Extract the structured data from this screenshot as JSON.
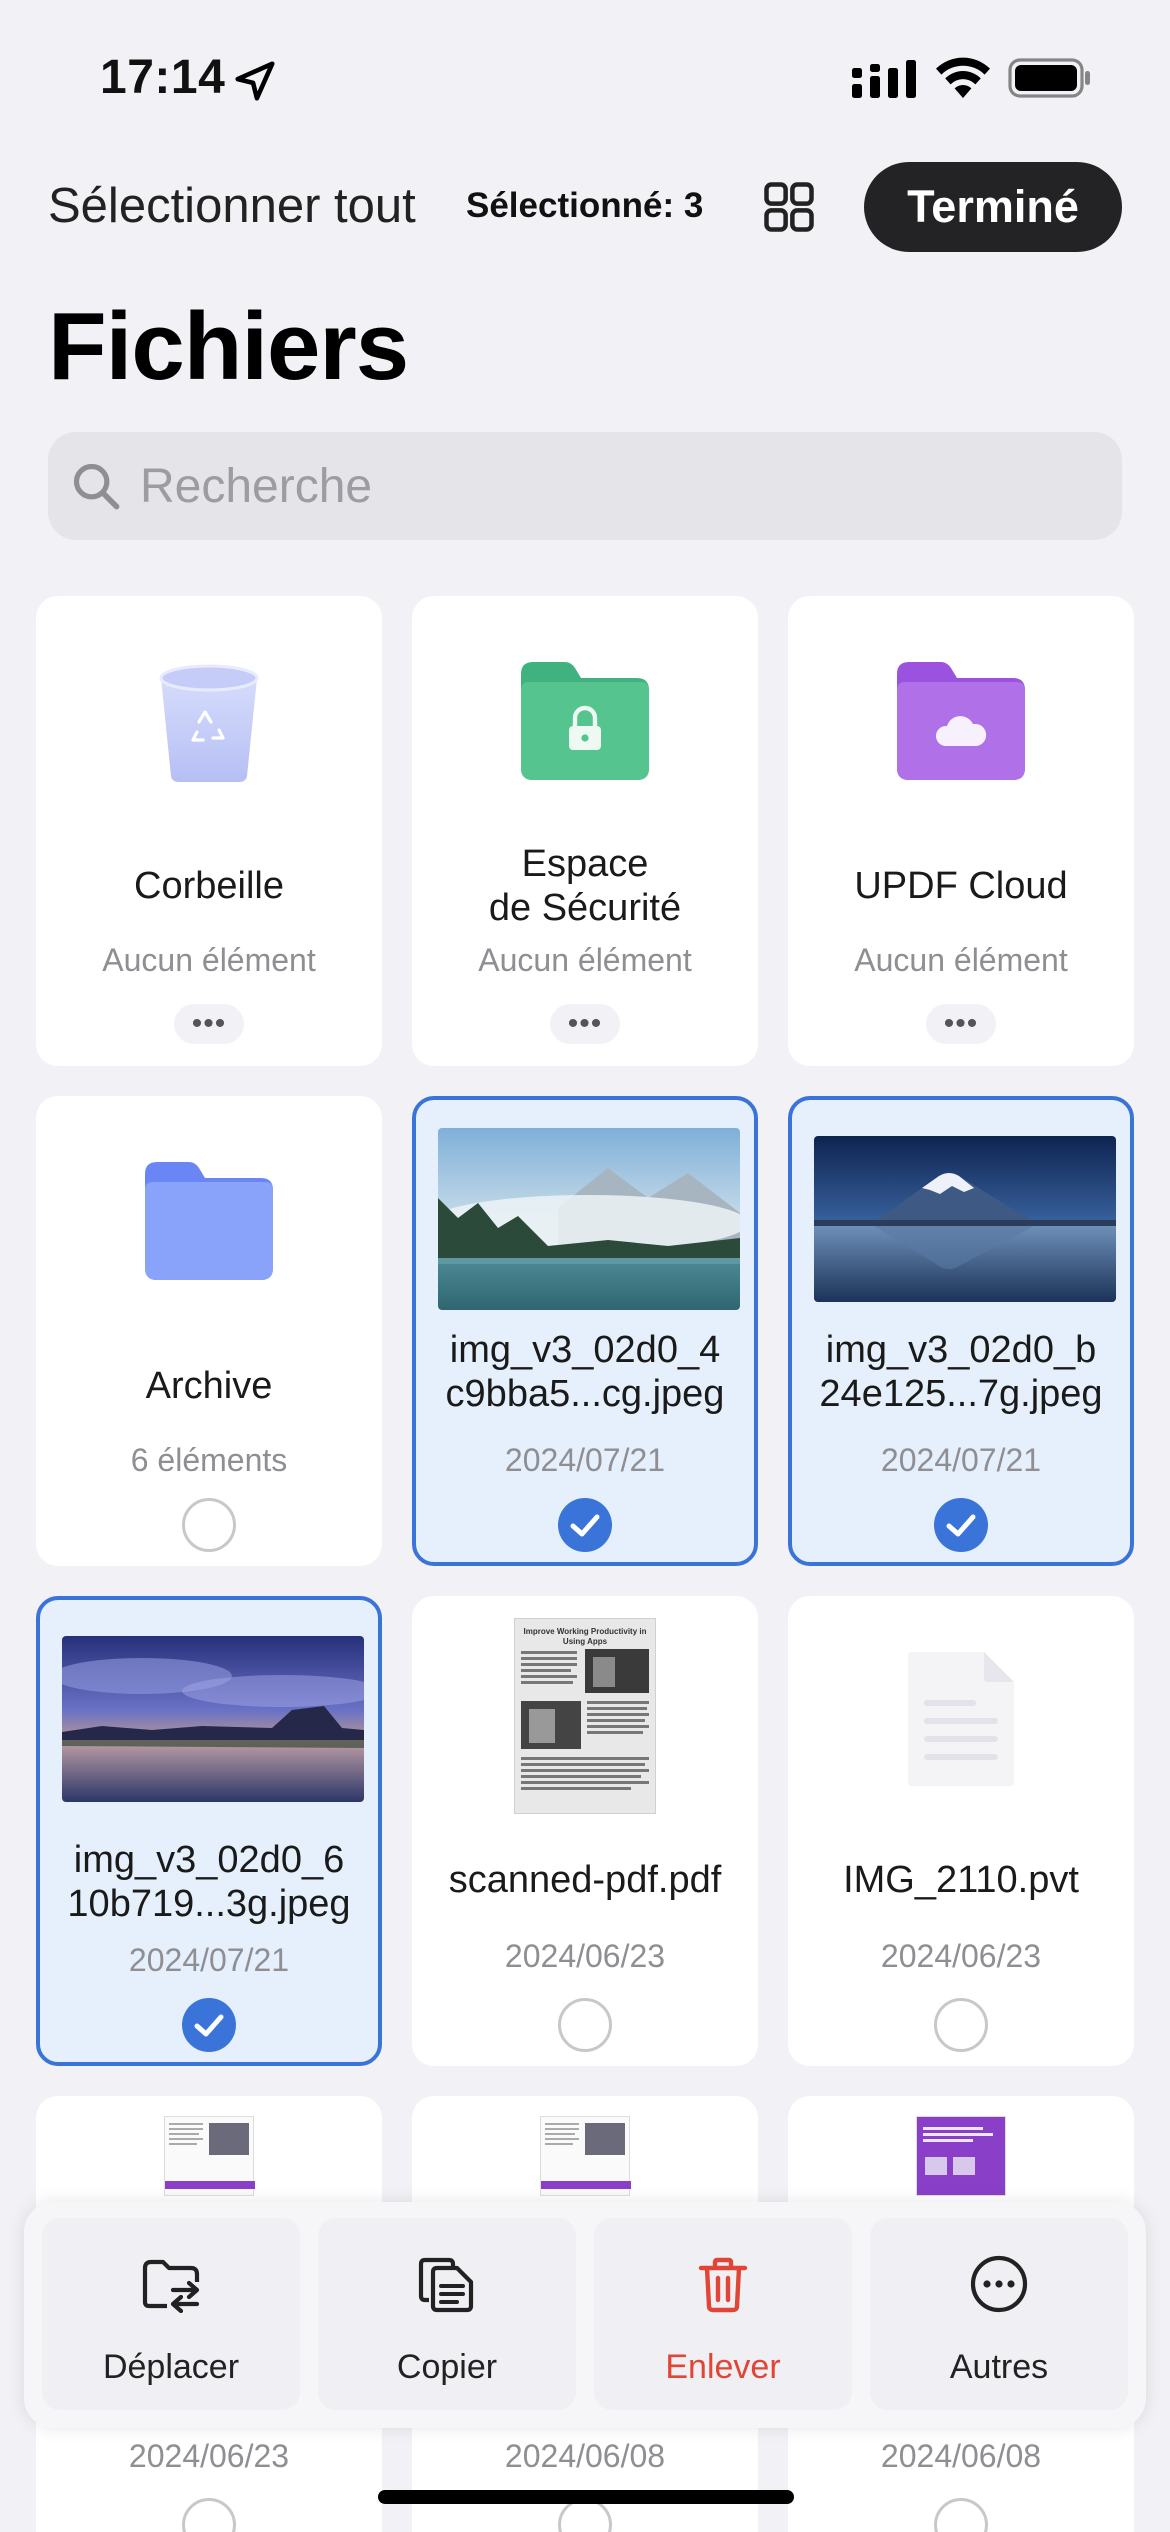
{
  "status_bar": {
    "time": "17:14"
  },
  "top_bar": {
    "select_all": "Sélectionner tout",
    "selected_count": "Sélectionné: 3",
    "done_label": "Terminé"
  },
  "page_title": "Fichiers",
  "search": {
    "placeholder": "Recherche"
  },
  "items": [
    {
      "name": "Corbeille",
      "meta": "Aucun élément",
      "icon": "trash-bin-icon",
      "selected": false
    },
    {
      "name_line1": "Espace",
      "name_line2": "de Sécurité",
      "meta": "Aucun élément",
      "icon": "secure-folder-icon",
      "selected": false
    },
    {
      "name": "UPDF Cloud",
      "meta": "Aucun élément",
      "icon": "cloud-folder-icon",
      "selected": false
    },
    {
      "name": "Archive",
      "meta": "6 éléments",
      "icon": "folder-icon",
      "selected": false
    },
    {
      "name_line1": "img_v3_02d0_4",
      "name_line2": "c9bba5...cg.jpeg",
      "meta": "2024/07/21",
      "icon": "image-thumbnail",
      "selected": true
    },
    {
      "name_line1": "img_v3_02d0_b",
      "name_line2": "24e125...7g.jpeg",
      "meta": "2024/07/21",
      "icon": "image-thumbnail",
      "selected": true
    },
    {
      "name_line1": "img_v3_02d0_6",
      "name_line2": "10b719...3g.jpeg",
      "meta": "2024/07/21",
      "icon": "image-thumbnail",
      "selected": true
    },
    {
      "name": "scanned-pdf.pdf",
      "meta": "2024/06/23",
      "icon": "pdf-thumbnail",
      "selected": false,
      "thumb_title": "Improve Working Productivity in Using Apps"
    },
    {
      "name": "IMG_2110.pvt",
      "meta": "2024/06/23",
      "icon": "document-icon",
      "selected": false
    },
    {
      "meta": "2024/06/23",
      "icon": "pdf-thumbnail"
    },
    {
      "meta": "2024/06/08",
      "icon": "pdf-thumbnail"
    },
    {
      "meta": "2024/06/08",
      "icon": "pdf-thumbnail"
    }
  ],
  "actions": {
    "move": "Déplacer",
    "copy": "Copier",
    "remove": "Enlever",
    "others": "Autres"
  },
  "colors": {
    "accent": "#3a74d8",
    "selected_bg": "#e5f0fc",
    "danger": "#e04535",
    "secure_folder": "#3fb27f",
    "cloud_folder": "#a45fe0",
    "archive_folder": "#6f8ff6"
  }
}
